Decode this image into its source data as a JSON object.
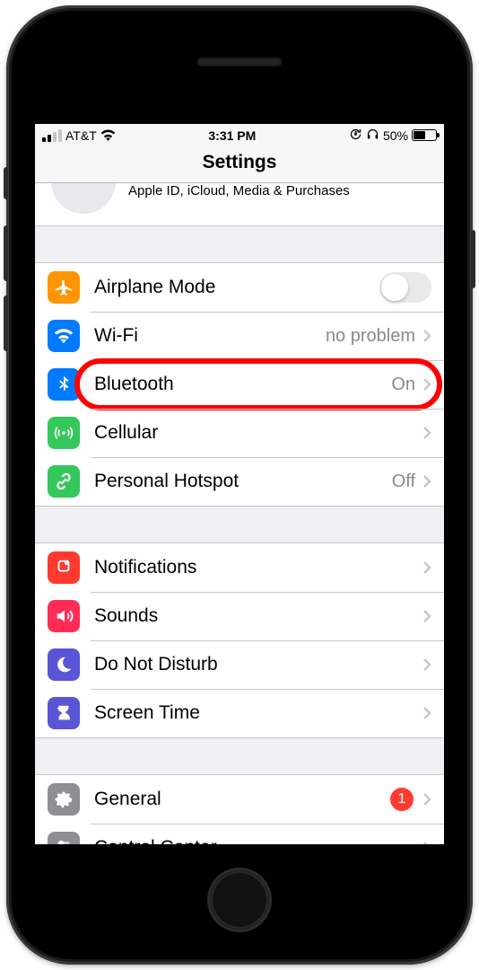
{
  "statusbar": {
    "carrier": "AT&T",
    "time": "3:31 PM",
    "battery_pct": "50%"
  },
  "nav": {
    "title": "Settings"
  },
  "profile": {
    "subtitle": "Apple ID, iCloud, Media & Purchases"
  },
  "groups": [
    {
      "items": [
        {
          "icon": "airplane",
          "color": "c-orange",
          "label": "Airplane Mode",
          "control": "toggle",
          "toggle_on": false
        },
        {
          "icon": "wifi",
          "color": "c-blue",
          "label": "Wi-Fi",
          "value": "no problem"
        },
        {
          "icon": "bluetooth",
          "color": "c-blue",
          "label": "Bluetooth",
          "value": "On",
          "highlight": true
        },
        {
          "icon": "antenna",
          "color": "c-green",
          "label": "Cellular"
        },
        {
          "icon": "link",
          "color": "c-green",
          "label": "Personal Hotspot",
          "value": "Off"
        }
      ]
    },
    {
      "items": [
        {
          "icon": "bell",
          "color": "c-red",
          "label": "Notifications"
        },
        {
          "icon": "speaker",
          "color": "c-pink",
          "label": "Sounds"
        },
        {
          "icon": "moon",
          "color": "c-purple",
          "label": "Do Not Disturb"
        },
        {
          "icon": "hourglass",
          "color": "c-purple",
          "label": "Screen Time"
        }
      ]
    },
    {
      "items": [
        {
          "icon": "gear",
          "color": "c-gray",
          "label": "General",
          "badge": "1"
        },
        {
          "icon": "sliders",
          "color": "c-gray",
          "label": "Control Center"
        }
      ]
    }
  ]
}
